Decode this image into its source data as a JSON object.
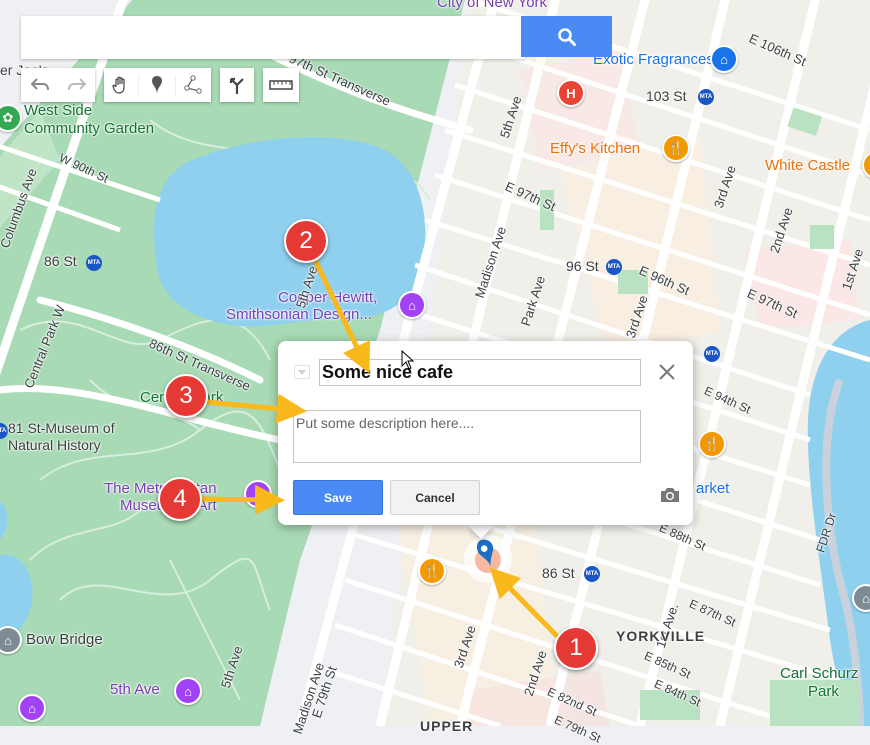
{
  "search": {
    "value": "",
    "placeholder": "",
    "button_icon": "search-icon"
  },
  "toolbar": {
    "tools": [
      {
        "id": "undo",
        "icon": "undo-icon"
      },
      {
        "id": "redo",
        "icon": "redo-icon"
      },
      {
        "id": "pan",
        "icon": "hand-icon"
      },
      {
        "id": "marker",
        "icon": "marker-icon"
      },
      {
        "id": "line",
        "icon": "draw-line-icon"
      },
      {
        "id": "directions",
        "icon": "directions-icon"
      },
      {
        "id": "measure",
        "icon": "ruler-icon"
      }
    ]
  },
  "map": {
    "streets": [
      "Columbus Ave",
      "W 90th St",
      "Central Park W",
      "86th St Transverse",
      "97th St Transverse",
      "5th Ave",
      "E 97th St",
      "Madison Ave",
      "Park Ave",
      "E 96th St",
      "3rd Ave",
      "2nd Ave",
      "1st Ave",
      "E 106th St",
      "E 97th St",
      "E 94th St",
      "E 88th St",
      "E 87th St",
      "E 85th St",
      "E 84th St",
      "E 82nd St",
      "E 79th St",
      "1st Ave.",
      "FDR Dr",
      "5th Ave",
      "E 79th St"
    ],
    "places": {
      "city_label": "City of New York",
      "trader_joes": "er Joe's",
      "west_side_garden": [
        "West Side",
        "Community Garden"
      ],
      "exotic_fragrances": "Exotic Fragrances",
      "effys_kitchen": "Effy's Kitchen",
      "white_castle": "White Castle",
      "cooper_hewitt": [
        "Cooper Hewitt,",
        "Smithsonian Design..."
      ],
      "museum_natural_history": [
        "81 St-Museum of",
        "Natural History"
      ],
      "the_met": [
        "The Metropolitan",
        "Museum of Art"
      ],
      "central_park": "Central Park",
      "market": "arket",
      "bow_bridge": "Bow Bridge",
      "fifth_ave_station": "5th Ave",
      "yorkville": "YORKVILLE",
      "carl_schurz": [
        "Carl Schurz",
        "Park"
      ],
      "upper": "UPPER"
    },
    "stations": [
      "103 St",
      "96 St",
      "86 St",
      "86 St"
    ],
    "metro_glyph": "MTA",
    "hospital_glyph": "H",
    "food_glyph": "🍴"
  },
  "popup": {
    "title_value": "Some nice cafe",
    "description_placeholder": "Put some description here....",
    "save_label": "Save",
    "cancel_label": "Cancel"
  },
  "annotations": {
    "badges": [
      "1",
      "2",
      "3",
      "4"
    ],
    "badge_color": "#e53935",
    "arrow_color": "#f9b81b"
  },
  "colors": {
    "park": "#a8dab5",
    "water": "#8fd0ee",
    "road": "#ffffff",
    "accent": "#4a8af4"
  }
}
